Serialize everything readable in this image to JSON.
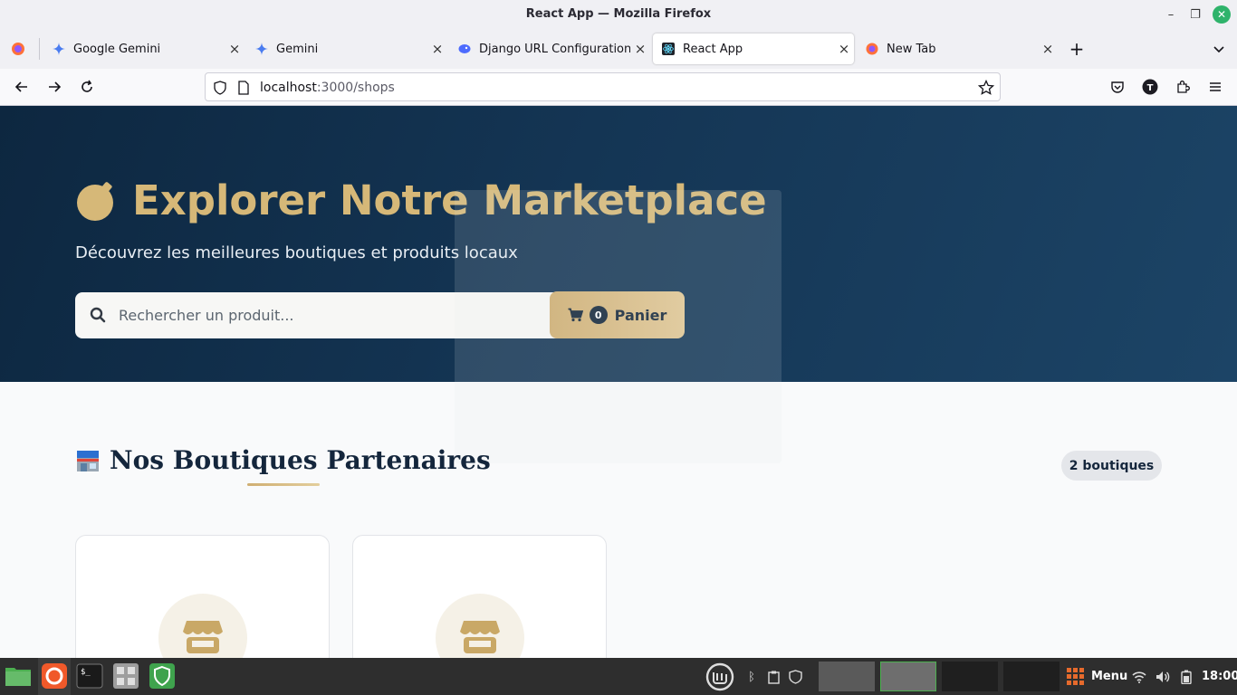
{
  "window": {
    "title": "React App — Mozilla Firefox"
  },
  "tabs": [
    {
      "label": "Google Gemini",
      "icon": "gemini-icon",
      "active": false
    },
    {
      "label": "Gemini",
      "icon": "gemini-icon",
      "active": false
    },
    {
      "label": "Django URL Configuration f",
      "icon": "deepseek-icon",
      "active": false
    },
    {
      "label": "React App",
      "icon": "react-icon",
      "active": true
    },
    {
      "label": "New Tab",
      "icon": "firefox-icon",
      "active": false
    }
  ],
  "urlbar": {
    "host": "localhost",
    "path": ":3000/shops"
  },
  "hero": {
    "title": "Explorer Notre Marketplace",
    "subtitle": "Découvrez les meilleures boutiques et produits locaux",
    "search_placeholder": "Rechercher un produit...",
    "cart_count": "0",
    "cart_label": "Panier"
  },
  "section": {
    "title": "Nos Boutiques Partenaires",
    "count_label": "2 boutiques"
  },
  "shops": [
    {
      "icon": "store-icon"
    },
    {
      "icon": "store-icon"
    }
  ],
  "taskbar": {
    "menu_label": "Menu",
    "clock": "18:00"
  },
  "colors": {
    "hero_bg": "#143554",
    "gold": "#d6b878",
    "navy": "#14263c",
    "taskbar": "#2e2e2e"
  }
}
